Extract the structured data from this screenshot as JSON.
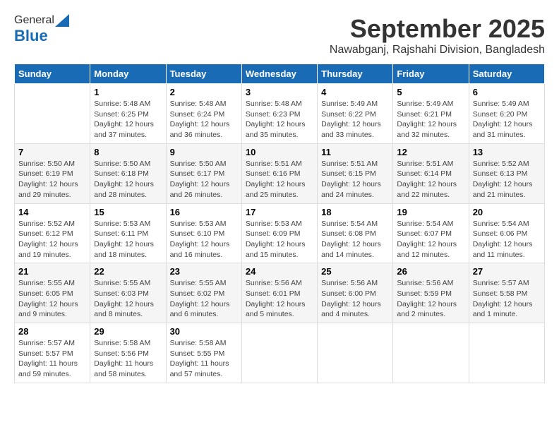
{
  "logo": {
    "general": "General",
    "blue": "Blue"
  },
  "title": "September 2025",
  "subtitle": "Nawabganj, Rajshahi Division, Bangladesh",
  "days_of_week": [
    "Sunday",
    "Monday",
    "Tuesday",
    "Wednesday",
    "Thursday",
    "Friday",
    "Saturday"
  ],
  "weeks": [
    [
      {
        "day": "",
        "info": ""
      },
      {
        "day": "1",
        "info": "Sunrise: 5:48 AM\nSunset: 6:25 PM\nDaylight: 12 hours\nand 37 minutes."
      },
      {
        "day": "2",
        "info": "Sunrise: 5:48 AM\nSunset: 6:24 PM\nDaylight: 12 hours\nand 36 minutes."
      },
      {
        "day": "3",
        "info": "Sunrise: 5:48 AM\nSunset: 6:23 PM\nDaylight: 12 hours\nand 35 minutes."
      },
      {
        "day": "4",
        "info": "Sunrise: 5:49 AM\nSunset: 6:22 PM\nDaylight: 12 hours\nand 33 minutes."
      },
      {
        "day": "5",
        "info": "Sunrise: 5:49 AM\nSunset: 6:21 PM\nDaylight: 12 hours\nand 32 minutes."
      },
      {
        "day": "6",
        "info": "Sunrise: 5:49 AM\nSunset: 6:20 PM\nDaylight: 12 hours\nand 31 minutes."
      }
    ],
    [
      {
        "day": "7",
        "info": "Sunrise: 5:50 AM\nSunset: 6:19 PM\nDaylight: 12 hours\nand 29 minutes."
      },
      {
        "day": "8",
        "info": "Sunrise: 5:50 AM\nSunset: 6:18 PM\nDaylight: 12 hours\nand 28 minutes."
      },
      {
        "day": "9",
        "info": "Sunrise: 5:50 AM\nSunset: 6:17 PM\nDaylight: 12 hours\nand 26 minutes."
      },
      {
        "day": "10",
        "info": "Sunrise: 5:51 AM\nSunset: 6:16 PM\nDaylight: 12 hours\nand 25 minutes."
      },
      {
        "day": "11",
        "info": "Sunrise: 5:51 AM\nSunset: 6:15 PM\nDaylight: 12 hours\nand 24 minutes."
      },
      {
        "day": "12",
        "info": "Sunrise: 5:51 AM\nSunset: 6:14 PM\nDaylight: 12 hours\nand 22 minutes."
      },
      {
        "day": "13",
        "info": "Sunrise: 5:52 AM\nSunset: 6:13 PM\nDaylight: 12 hours\nand 21 minutes."
      }
    ],
    [
      {
        "day": "14",
        "info": "Sunrise: 5:52 AM\nSunset: 6:12 PM\nDaylight: 12 hours\nand 19 minutes."
      },
      {
        "day": "15",
        "info": "Sunrise: 5:53 AM\nSunset: 6:11 PM\nDaylight: 12 hours\nand 18 minutes."
      },
      {
        "day": "16",
        "info": "Sunrise: 5:53 AM\nSunset: 6:10 PM\nDaylight: 12 hours\nand 16 minutes."
      },
      {
        "day": "17",
        "info": "Sunrise: 5:53 AM\nSunset: 6:09 PM\nDaylight: 12 hours\nand 15 minutes."
      },
      {
        "day": "18",
        "info": "Sunrise: 5:54 AM\nSunset: 6:08 PM\nDaylight: 12 hours\nand 14 minutes."
      },
      {
        "day": "19",
        "info": "Sunrise: 5:54 AM\nSunset: 6:07 PM\nDaylight: 12 hours\nand 12 minutes."
      },
      {
        "day": "20",
        "info": "Sunrise: 5:54 AM\nSunset: 6:06 PM\nDaylight: 12 hours\nand 11 minutes."
      }
    ],
    [
      {
        "day": "21",
        "info": "Sunrise: 5:55 AM\nSunset: 6:05 PM\nDaylight: 12 hours\nand 9 minutes."
      },
      {
        "day": "22",
        "info": "Sunrise: 5:55 AM\nSunset: 6:03 PM\nDaylight: 12 hours\nand 8 minutes."
      },
      {
        "day": "23",
        "info": "Sunrise: 5:55 AM\nSunset: 6:02 PM\nDaylight: 12 hours\nand 6 minutes."
      },
      {
        "day": "24",
        "info": "Sunrise: 5:56 AM\nSunset: 6:01 PM\nDaylight: 12 hours\nand 5 minutes."
      },
      {
        "day": "25",
        "info": "Sunrise: 5:56 AM\nSunset: 6:00 PM\nDaylight: 12 hours\nand 4 minutes."
      },
      {
        "day": "26",
        "info": "Sunrise: 5:56 AM\nSunset: 5:59 PM\nDaylight: 12 hours\nand 2 minutes."
      },
      {
        "day": "27",
        "info": "Sunrise: 5:57 AM\nSunset: 5:58 PM\nDaylight: 12 hours\nand 1 minute."
      }
    ],
    [
      {
        "day": "28",
        "info": "Sunrise: 5:57 AM\nSunset: 5:57 PM\nDaylight: 11 hours\nand 59 minutes."
      },
      {
        "day": "29",
        "info": "Sunrise: 5:58 AM\nSunset: 5:56 PM\nDaylight: 11 hours\nand 58 minutes."
      },
      {
        "day": "30",
        "info": "Sunrise: 5:58 AM\nSunset: 5:55 PM\nDaylight: 11 hours\nand 57 minutes."
      },
      {
        "day": "",
        "info": ""
      },
      {
        "day": "",
        "info": ""
      },
      {
        "day": "",
        "info": ""
      },
      {
        "day": "",
        "info": ""
      }
    ]
  ]
}
